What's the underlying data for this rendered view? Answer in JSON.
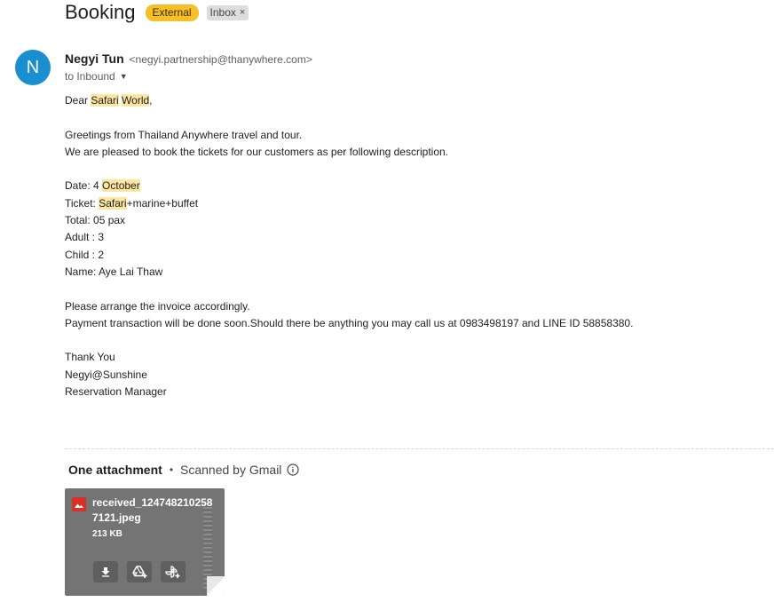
{
  "subject": {
    "title": "Booking",
    "badges": {
      "external": "External",
      "inbox": "Inbox",
      "inbox_remove": "×"
    }
  },
  "sender": {
    "avatar_letter": "N",
    "avatar_color": "#1a8fd0",
    "name": "Negyi Tun",
    "email": "<negyi.partnership@thanywhere.com>",
    "recipient": "to Inbound"
  },
  "body": {
    "greeting_prefix": "Dear ",
    "greeting_hl1": "Safari",
    "greeting_sep": " ",
    "greeting_hl2": "World",
    "greeting_suffix": ",",
    "p1_line1": "Greetings from Thailand Anywhere travel and tour.",
    "p1_line2": "We are pleased to book the tickets for our customers as per following description.",
    "date_prefix": "Date:  4 ",
    "date_hl": "October",
    "ticket_prefix": "Ticket: ",
    "ticket_hl": "Safari",
    "ticket_suffix": "+marine+buffet",
    "total": "Total: 05 pax",
    "adult": "Adult : 3",
    "child": "Child : 2",
    "name": "Name: Aye Lai Thaw",
    "p2_line1": "Please arrange the invoice accordingly.",
    "p2_line2": "Payment transaction will be done soon.Should there be anything you may call us at 0983498197 and LINE ID 58858380.",
    "sign1": "Thank You",
    "sign2": "Negyi@Sunshine",
    "sign3": "Reservation Manager"
  },
  "attachments": {
    "count_label": "One attachment",
    "dot": "•",
    "scan_label": "Scanned by Gmail",
    "file_name": "received_1247482102587121.jpeg",
    "file_size": "213 KB",
    "icons": [
      "download-icon",
      "add-to-drive-icon",
      "add-to-photos-icon"
    ]
  },
  "colors": {
    "highlight": "#fbe6a2",
    "external_badge": "#f6c026",
    "file_icon": "#d93025"
  }
}
